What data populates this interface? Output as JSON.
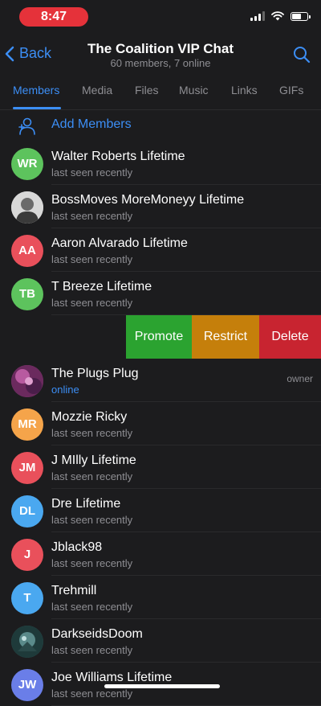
{
  "status_bar": {
    "time": "8:47",
    "time_pill_color": "#e5323a"
  },
  "nav": {
    "back_label": "Back",
    "title": "The Coalition VIP Chat",
    "subtitle": "60 members, 7 online"
  },
  "tabs": [
    {
      "label": "Members",
      "active": true
    },
    {
      "label": "Media",
      "active": false
    },
    {
      "label": "Files",
      "active": false
    },
    {
      "label": "Music",
      "active": false
    },
    {
      "label": "Links",
      "active": false
    },
    {
      "label": "GIFs",
      "active": false
    }
  ],
  "add_members": {
    "label": "Add Members"
  },
  "swipe_actions": {
    "promote": "Promote",
    "restrict": "Restrict",
    "delete": "Delete"
  },
  "members": [
    {
      "initials": "WR",
      "name": "Walter Roberts Lifetime",
      "status": "last seen recently",
      "color": "#5dc35d"
    },
    {
      "initials": "",
      "name": "BossMoves MoreMoneyy Lifetime",
      "status": "last seen recently",
      "color": "#d8d8d8"
    },
    {
      "initials": "AA",
      "name": "Aaron Alvarado Lifetime",
      "status": "last seen recently",
      "color": "#e9505b"
    },
    {
      "initials": "TB",
      "name": "T Breeze Lifetime",
      "status": "last seen recently",
      "color": "#5dc35d"
    },
    {
      "initials": "",
      "name": "The Plugs Plug",
      "status": "online",
      "role": "owner",
      "color": "#9a4a8a"
    },
    {
      "initials": "MR",
      "name": "Mozzie Ricky",
      "status": "last seen recently",
      "color": "#f5a44a"
    },
    {
      "initials": "JM",
      "name": "J MIlly Lifetime",
      "status": "last seen recently",
      "color": "#e9505b"
    },
    {
      "initials": "DL",
      "name": "Dre Lifetime",
      "status": "last seen recently",
      "color": "#4aa8f0"
    },
    {
      "initials": "J",
      "name": "Jblack98",
      "status": "last seen recently",
      "color": "#e9505b"
    },
    {
      "initials": "T",
      "name": "Trehmill",
      "status": "last seen recently",
      "color": "#4aa8f0"
    },
    {
      "initials": "",
      "name": "DarkseidsDoom",
      "status": "last seen recently",
      "color": "#3a6a6a"
    },
    {
      "initials": "JW",
      "name": "Joe Williams Lifetime",
      "status": "last seen recently",
      "color": "#6a7ee8"
    }
  ],
  "colors": {
    "accent": "#3c8ef5",
    "background": "#1c1c1e",
    "secondary_text": "#8e8e93"
  }
}
